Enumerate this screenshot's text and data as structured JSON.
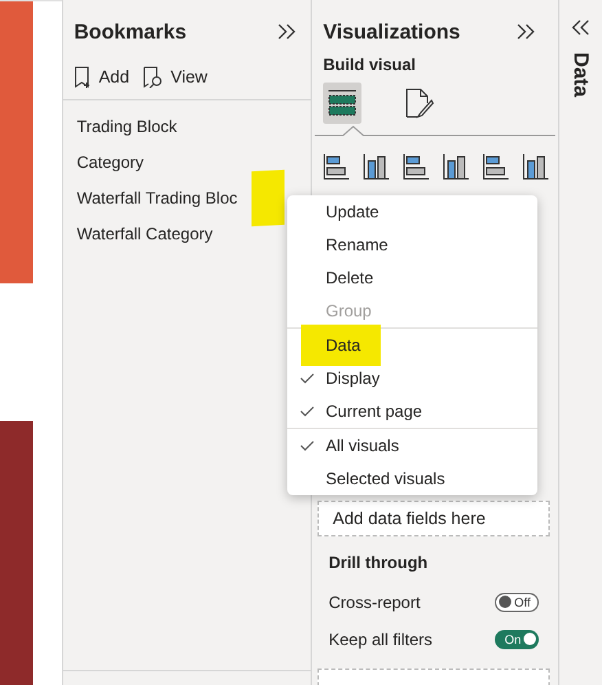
{
  "bookmarks_pane": {
    "title": "Bookmarks",
    "actions": [
      {
        "kind": "add",
        "label": "Add"
      },
      {
        "kind": "view",
        "label": "View"
      }
    ],
    "items": [
      {
        "label": "Trading Block",
        "highlighted": false
      },
      {
        "label": "Category",
        "highlighted": false
      },
      {
        "label": "Waterfall Trading Bloc",
        "highlighted": true
      },
      {
        "label": "Waterfall Category",
        "highlighted": false
      }
    ]
  },
  "visualizations_pane": {
    "title": "Visualizations",
    "section": "Build visual",
    "tabs": [
      {
        "kind": "build",
        "selected": true
      },
      {
        "kind": "format",
        "selected": false
      }
    ],
    "drop_well": "Add data fields here",
    "drill_through": {
      "title": "Drill through",
      "toggles": [
        {
          "label": "Cross-report",
          "on": false,
          "text": "Off"
        },
        {
          "label": "Keep all filters",
          "on": true,
          "text": "On"
        }
      ]
    }
  },
  "data_pane": {
    "title": "Data"
  },
  "context_menu": {
    "groups": [
      [
        {
          "label": "Update",
          "checked": false,
          "disabled": false,
          "highlighted": false
        },
        {
          "label": "Rename",
          "checked": false,
          "disabled": false,
          "highlighted": false
        },
        {
          "label": "Delete",
          "checked": false,
          "disabled": false,
          "highlighted": false
        },
        {
          "label": "Group",
          "checked": false,
          "disabled": true,
          "highlighted": false
        }
      ],
      [
        {
          "label": "Data",
          "checked": false,
          "disabled": false,
          "highlighted": true
        },
        {
          "label": "Display",
          "checked": true,
          "disabled": false,
          "highlighted": false
        },
        {
          "label": "Current page",
          "checked": true,
          "disabled": false,
          "highlighted": false
        }
      ],
      [
        {
          "label": "All visuals",
          "checked": true,
          "disabled": false,
          "highlighted": false
        },
        {
          "label": "Selected visuals",
          "checked": false,
          "disabled": false,
          "highlighted": false
        }
      ]
    ]
  }
}
